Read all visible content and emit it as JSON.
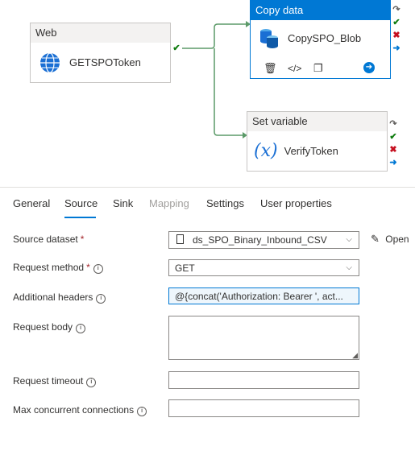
{
  "pipeline": {
    "web_node": {
      "type_label": "Web",
      "name": "GETSPOToken"
    },
    "copy_node": {
      "type_label": "Copy data",
      "name": "CopySPO_Blob"
    },
    "setvar_node": {
      "type_label": "Set variable",
      "name": "VerifyToken"
    },
    "colors": {
      "accent": "#0078d4",
      "success": "#107c10",
      "fail": "#c50f1f",
      "edge": "#5b9a68"
    }
  },
  "tabs": [
    {
      "label": "General"
    },
    {
      "label": "Source"
    },
    {
      "label": "Sink"
    },
    {
      "label": "Mapping"
    },
    {
      "label": "Settings"
    },
    {
      "label": "User properties"
    }
  ],
  "form": {
    "source_dataset": {
      "label": "Source dataset",
      "required": "*",
      "value": "ds_SPO_Binary_Inbound_CSV",
      "open_label": "Open"
    },
    "request_method": {
      "label": "Request method",
      "required": "*",
      "value": "GET"
    },
    "additional_headers": {
      "label": "Additional headers",
      "value": "@{concat('Authorization: Bearer ', act..."
    },
    "request_body": {
      "label": "Request body",
      "value": ""
    },
    "request_timeout": {
      "label": "Request timeout",
      "value": ""
    },
    "max_connections": {
      "label": "Max concurrent connections",
      "value": ""
    }
  }
}
